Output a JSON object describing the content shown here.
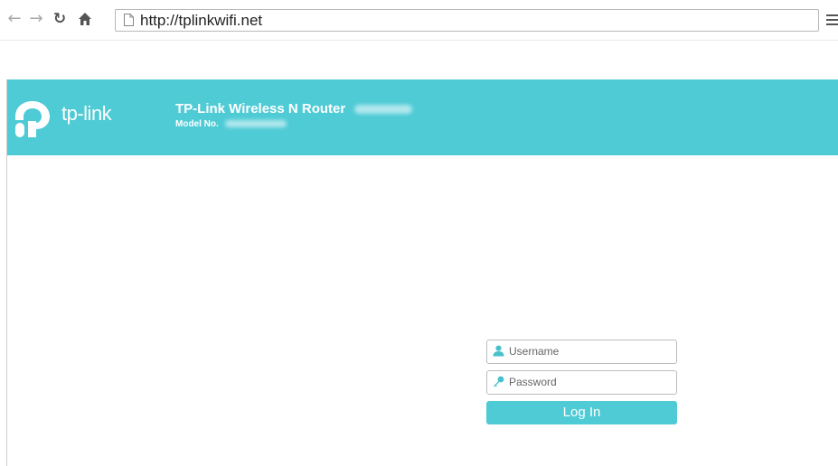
{
  "browser": {
    "url": "http://tplinkwifi.net",
    "icons": {
      "back": "arrow-left-icon",
      "forward": "arrow-right-icon",
      "reload": "reload-icon",
      "home": "home-icon",
      "page": "page-icon",
      "menu": "menu-icon"
    }
  },
  "header": {
    "brand": "tp-link",
    "router_title": "TP-Link Wireless N Router",
    "model_label": "Model No.",
    "background_color": "#4fcbd6"
  },
  "login": {
    "username_placeholder": "Username",
    "password_placeholder": "Password",
    "login_label": "Log In",
    "button_color": "#4fcbd6"
  }
}
